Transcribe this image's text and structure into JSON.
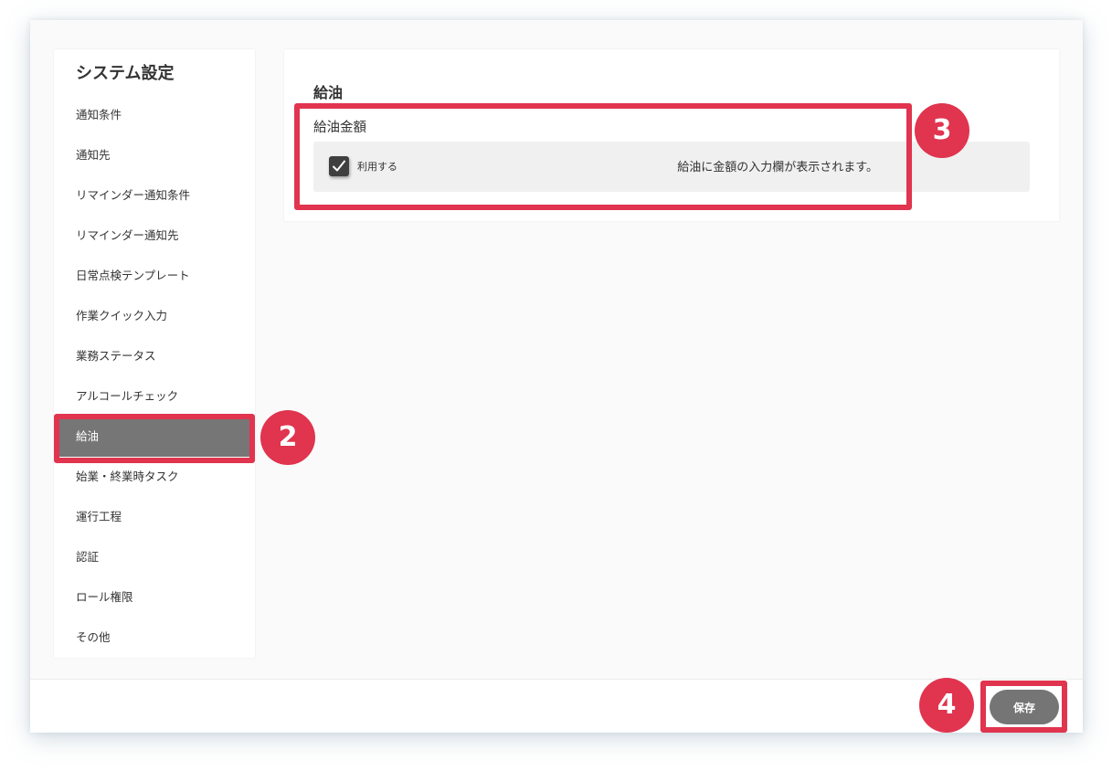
{
  "sidebar": {
    "title": "システム設定",
    "items": [
      {
        "label": "通知条件"
      },
      {
        "label": "通知先"
      },
      {
        "label": "リマインダー通知条件"
      },
      {
        "label": "リマインダー通知先"
      },
      {
        "label": "日常点検テンプレート"
      },
      {
        "label": "作業クイック入力"
      },
      {
        "label": "業務ステータス"
      },
      {
        "label": "アルコールチェック"
      },
      {
        "label": "給油",
        "active": true
      },
      {
        "label": "始業・終業時タスク"
      },
      {
        "label": "運行工程"
      },
      {
        "label": "認証"
      },
      {
        "label": "ロール権限"
      },
      {
        "label": "その他"
      }
    ]
  },
  "main": {
    "section_title": "給油",
    "field_label": "給油金額",
    "option": {
      "checkbox_label": "利用する",
      "checked": true,
      "description": "給油に金額の入力欄が表示されます。"
    }
  },
  "footer": {
    "save_label": "保存"
  },
  "annotations": {
    "badge_2": "2",
    "badge_3": "3",
    "badge_4": "4",
    "highlight_color": "#e0344f"
  },
  "colors": {
    "active_item_bg": "#767676",
    "checkbox_bg": "#3f3f3f",
    "save_button_bg": "#757575"
  }
}
